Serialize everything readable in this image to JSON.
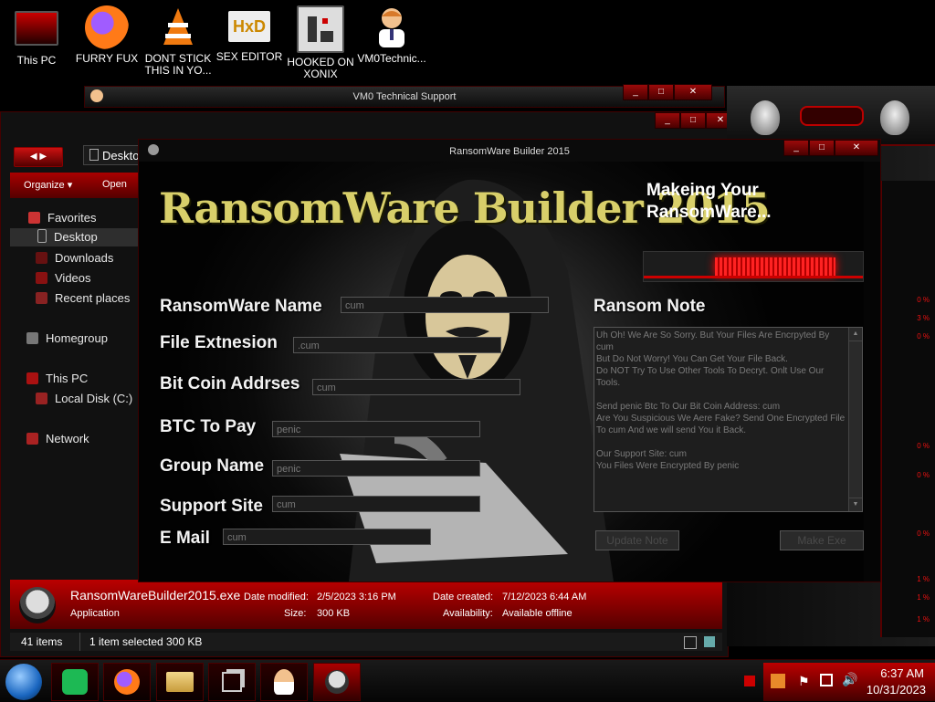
{
  "desktop_icons": [
    {
      "label": "This PC",
      "icon": "monitor-icon"
    },
    {
      "label": "FURRY FUX",
      "icon": "firefox-icon"
    },
    {
      "label": "DONT STICK THIS IN YO...",
      "icon": "vlc-cone-icon"
    },
    {
      "label": "SEX EDITOR",
      "icon": "hxd-icon"
    },
    {
      "label": "HOOKED ON XONIX",
      "icon": "xonix-icon"
    },
    {
      "label": "VM0Technic...",
      "icon": "doctor-icon"
    }
  ],
  "vm0_window": {
    "title": "VM0 Technical Support"
  },
  "explorer": {
    "address": "Desktop",
    "toolbar": {
      "organize": "Organize ▾",
      "open": "Open"
    },
    "nav": {
      "favorites": "Favorites",
      "desktop": "Desktop",
      "downloads": "Downloads",
      "videos": "Videos",
      "recent": "Recent places",
      "homegroup": "Homegroup",
      "thispc": "This PC",
      "localdisk": "Local Disk (C:)",
      "network": "Network"
    },
    "details": {
      "filename": "RansomWareBuilder2015.exe",
      "type": "Application",
      "date_modified_label": "Date modified:",
      "date_modified": "2/5/2023 3:16 PM",
      "size_label": "Size:",
      "size": "300 KB",
      "date_created_label": "Date created:",
      "date_created": "7/12/2023 6:44 AM",
      "availability_label": "Availability:",
      "availability": "Available offline"
    },
    "status": {
      "items": "41 items",
      "selected": "1 item selected  300 KB"
    }
  },
  "builder": {
    "title": "RansomWare Builder 2015",
    "logo": "RansomWare Builder 2015",
    "status_msg": "Makeing Your RansomWare...",
    "progress": 0.6,
    "fields": {
      "name_label": "RansomWare Name",
      "name_value": "cum",
      "ext_label": "File Extnesion",
      "ext_value": ".cum",
      "btc_addr_label": "Bit Coin Addrses",
      "btc_addr_value": "cum",
      "btc_pay_label": "BTC To Pay",
      "btc_pay_value": "penic",
      "group_label": "Group Name",
      "group_value": "penic",
      "site_label": "Support Site",
      "site_value": "cum",
      "email_label": "E Mail",
      "email_value": "cum"
    },
    "note_label": "Ransom Note",
    "note_text": "Uh Oh! We Are So Sorry. But Your Files Are Encrpyted By cum\nBut Do Not Worry! You Can Get Your File Back.\nDo NOT Try To Use Other Tools To Decryt. Onlt Use Our Tools.\n\nSend penic Btc To Our Bit Coin Address: cum\nAre You Suspicious We Aere Fake? Send One Encrypted File To cum And we will send You it Back.\n\nOur Support Site: cum\nYou Files Were Encrypted By penic",
    "update_note": "Update Note",
    "make_exe": "Make Exe"
  },
  "gadget": {
    "readouts": [
      "0 %",
      "3 %",
      "0 %",
      "0 %",
      "0 %",
      "0 %",
      "1 %",
      "1 %",
      "1 %"
    ]
  },
  "taskbar": {
    "time": "6:37 AM",
    "date": "10/31/2023"
  },
  "colors": {
    "accent": "#b00000",
    "title_bg": "#0d0d0d",
    "logo": "#d8cf6a"
  }
}
